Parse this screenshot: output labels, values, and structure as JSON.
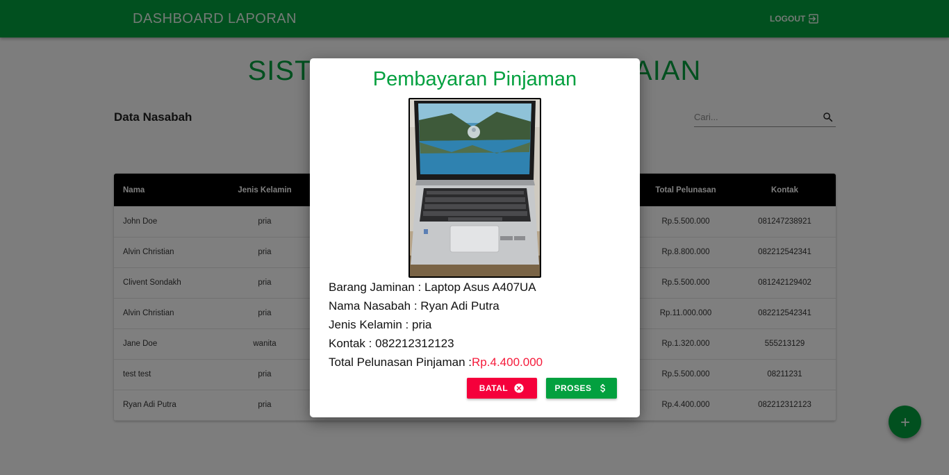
{
  "navbar": {
    "links": [
      "DASHBOARD",
      "LAPORAN"
    ],
    "logout_label": "LOGOUT"
  },
  "page": {
    "title": "SISTEM INFORMASI PEGADAIAN",
    "section_title": "Data Nasabah",
    "search_placeholder": "Cari..."
  },
  "table": {
    "columns": [
      "Nama",
      "Jenis Kelamin",
      "",
      "",
      "",
      "Total Pelunasan",
      "Kontak"
    ],
    "rows": [
      {
        "nama": "John Doe",
        "jk": "pria",
        "total": "Rp.5.500.000",
        "kontak": "081247238921"
      },
      {
        "nama": "Alvin Christian",
        "jk": "pria",
        "total": "Rp.8.800.000",
        "kontak": "082212542341"
      },
      {
        "nama": "Clivent Sondakh",
        "jk": "pria",
        "total": "Rp.5.500.000",
        "kontak": "081242129402"
      },
      {
        "nama": "Alvin Christian",
        "jk": "pria",
        "total": "Rp.11.000.000",
        "kontak": "082212542341"
      },
      {
        "nama": "Jane Doe",
        "jk": "wanita",
        "total": "Rp.1.320.000",
        "kontak": "555213129"
      },
      {
        "nama": "test test",
        "jk": "pria",
        "total": "Rp.5.500.000",
        "kontak": "08211231"
      },
      {
        "nama": "Ryan Adi Putra",
        "jk": "pria",
        "total": "Rp.4.400.000",
        "kontak": "082212312123"
      }
    ]
  },
  "modal": {
    "title": "Pembayaran Pinjaman",
    "barang_label": "Barang Jaminan : ",
    "barang": "Laptop Asus A407UA",
    "nama_label": "Nama Nasabah : ",
    "nama": "Ryan Adi Putra",
    "jk_label": "Jenis Kelamin : ",
    "jk": "pria",
    "kontak_label": "Kontak : ",
    "kontak": "082212312123",
    "total_label": "Total Pelunasan Pinjaman :",
    "total": "Rp.4.400.000",
    "cancel_label": "BATAL",
    "process_label": "PROSES"
  },
  "colors": {
    "primary": "#03a03f",
    "danger": "#f5003b",
    "price": "#f51a3a"
  },
  "icons": {
    "logout": "logout-icon",
    "search": "search-icon",
    "add": "plus-icon",
    "cancel": "close-circle-icon",
    "process": "dollar-icon"
  }
}
